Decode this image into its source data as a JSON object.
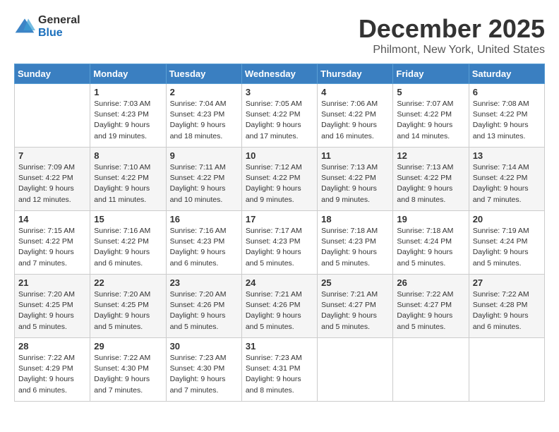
{
  "logo": {
    "general": "General",
    "blue": "Blue"
  },
  "title": "December 2025",
  "subtitle": "Philmont, New York, United States",
  "days_of_week": [
    "Sunday",
    "Monday",
    "Tuesday",
    "Wednesday",
    "Thursday",
    "Friday",
    "Saturday"
  ],
  "weeks": [
    [
      {
        "day": "",
        "sunrise": "",
        "sunset": "",
        "daylight": ""
      },
      {
        "day": "1",
        "sunrise": "Sunrise: 7:03 AM",
        "sunset": "Sunset: 4:23 PM",
        "daylight": "Daylight: 9 hours and 19 minutes."
      },
      {
        "day": "2",
        "sunrise": "Sunrise: 7:04 AM",
        "sunset": "Sunset: 4:23 PM",
        "daylight": "Daylight: 9 hours and 18 minutes."
      },
      {
        "day": "3",
        "sunrise": "Sunrise: 7:05 AM",
        "sunset": "Sunset: 4:22 PM",
        "daylight": "Daylight: 9 hours and 17 minutes."
      },
      {
        "day": "4",
        "sunrise": "Sunrise: 7:06 AM",
        "sunset": "Sunset: 4:22 PM",
        "daylight": "Daylight: 9 hours and 16 minutes."
      },
      {
        "day": "5",
        "sunrise": "Sunrise: 7:07 AM",
        "sunset": "Sunset: 4:22 PM",
        "daylight": "Daylight: 9 hours and 14 minutes."
      },
      {
        "day": "6",
        "sunrise": "Sunrise: 7:08 AM",
        "sunset": "Sunset: 4:22 PM",
        "daylight": "Daylight: 9 hours and 13 minutes."
      }
    ],
    [
      {
        "day": "7",
        "sunrise": "Sunrise: 7:09 AM",
        "sunset": "Sunset: 4:22 PM",
        "daylight": "Daylight: 9 hours and 12 minutes."
      },
      {
        "day": "8",
        "sunrise": "Sunrise: 7:10 AM",
        "sunset": "Sunset: 4:22 PM",
        "daylight": "Daylight: 9 hours and 11 minutes."
      },
      {
        "day": "9",
        "sunrise": "Sunrise: 7:11 AM",
        "sunset": "Sunset: 4:22 PM",
        "daylight": "Daylight: 9 hours and 10 minutes."
      },
      {
        "day": "10",
        "sunrise": "Sunrise: 7:12 AM",
        "sunset": "Sunset: 4:22 PM",
        "daylight": "Daylight: 9 hours and 9 minutes."
      },
      {
        "day": "11",
        "sunrise": "Sunrise: 7:13 AM",
        "sunset": "Sunset: 4:22 PM",
        "daylight": "Daylight: 9 hours and 9 minutes."
      },
      {
        "day": "12",
        "sunrise": "Sunrise: 7:13 AM",
        "sunset": "Sunset: 4:22 PM",
        "daylight": "Daylight: 9 hours and 8 minutes."
      },
      {
        "day": "13",
        "sunrise": "Sunrise: 7:14 AM",
        "sunset": "Sunset: 4:22 PM",
        "daylight": "Daylight: 9 hours and 7 minutes."
      }
    ],
    [
      {
        "day": "14",
        "sunrise": "Sunrise: 7:15 AM",
        "sunset": "Sunset: 4:22 PM",
        "daylight": "Daylight: 9 hours and 7 minutes."
      },
      {
        "day": "15",
        "sunrise": "Sunrise: 7:16 AM",
        "sunset": "Sunset: 4:22 PM",
        "daylight": "Daylight: 9 hours and 6 minutes."
      },
      {
        "day": "16",
        "sunrise": "Sunrise: 7:16 AM",
        "sunset": "Sunset: 4:23 PM",
        "daylight": "Daylight: 9 hours and 6 minutes."
      },
      {
        "day": "17",
        "sunrise": "Sunrise: 7:17 AM",
        "sunset": "Sunset: 4:23 PM",
        "daylight": "Daylight: 9 hours and 5 minutes."
      },
      {
        "day": "18",
        "sunrise": "Sunrise: 7:18 AM",
        "sunset": "Sunset: 4:23 PM",
        "daylight": "Daylight: 9 hours and 5 minutes."
      },
      {
        "day": "19",
        "sunrise": "Sunrise: 7:18 AM",
        "sunset": "Sunset: 4:24 PM",
        "daylight": "Daylight: 9 hours and 5 minutes."
      },
      {
        "day": "20",
        "sunrise": "Sunrise: 7:19 AM",
        "sunset": "Sunset: 4:24 PM",
        "daylight": "Daylight: 9 hours and 5 minutes."
      }
    ],
    [
      {
        "day": "21",
        "sunrise": "Sunrise: 7:20 AM",
        "sunset": "Sunset: 4:25 PM",
        "daylight": "Daylight: 9 hours and 5 minutes."
      },
      {
        "day": "22",
        "sunrise": "Sunrise: 7:20 AM",
        "sunset": "Sunset: 4:25 PM",
        "daylight": "Daylight: 9 hours and 5 minutes."
      },
      {
        "day": "23",
        "sunrise": "Sunrise: 7:20 AM",
        "sunset": "Sunset: 4:26 PM",
        "daylight": "Daylight: 9 hours and 5 minutes."
      },
      {
        "day": "24",
        "sunrise": "Sunrise: 7:21 AM",
        "sunset": "Sunset: 4:26 PM",
        "daylight": "Daylight: 9 hours and 5 minutes."
      },
      {
        "day": "25",
        "sunrise": "Sunrise: 7:21 AM",
        "sunset": "Sunset: 4:27 PM",
        "daylight": "Daylight: 9 hours and 5 minutes."
      },
      {
        "day": "26",
        "sunrise": "Sunrise: 7:22 AM",
        "sunset": "Sunset: 4:27 PM",
        "daylight": "Daylight: 9 hours and 5 minutes."
      },
      {
        "day": "27",
        "sunrise": "Sunrise: 7:22 AM",
        "sunset": "Sunset: 4:28 PM",
        "daylight": "Daylight: 9 hours and 6 minutes."
      }
    ],
    [
      {
        "day": "28",
        "sunrise": "Sunrise: 7:22 AM",
        "sunset": "Sunset: 4:29 PM",
        "daylight": "Daylight: 9 hours and 6 minutes."
      },
      {
        "day": "29",
        "sunrise": "Sunrise: 7:22 AM",
        "sunset": "Sunset: 4:30 PM",
        "daylight": "Daylight: 9 hours and 7 minutes."
      },
      {
        "day": "30",
        "sunrise": "Sunrise: 7:23 AM",
        "sunset": "Sunset: 4:30 PM",
        "daylight": "Daylight: 9 hours and 7 minutes."
      },
      {
        "day": "31",
        "sunrise": "Sunrise: 7:23 AM",
        "sunset": "Sunset: 4:31 PM",
        "daylight": "Daylight: 9 hours and 8 minutes."
      },
      {
        "day": "",
        "sunrise": "",
        "sunset": "",
        "daylight": ""
      },
      {
        "day": "",
        "sunrise": "",
        "sunset": "",
        "daylight": ""
      },
      {
        "day": "",
        "sunrise": "",
        "sunset": "",
        "daylight": ""
      }
    ]
  ]
}
